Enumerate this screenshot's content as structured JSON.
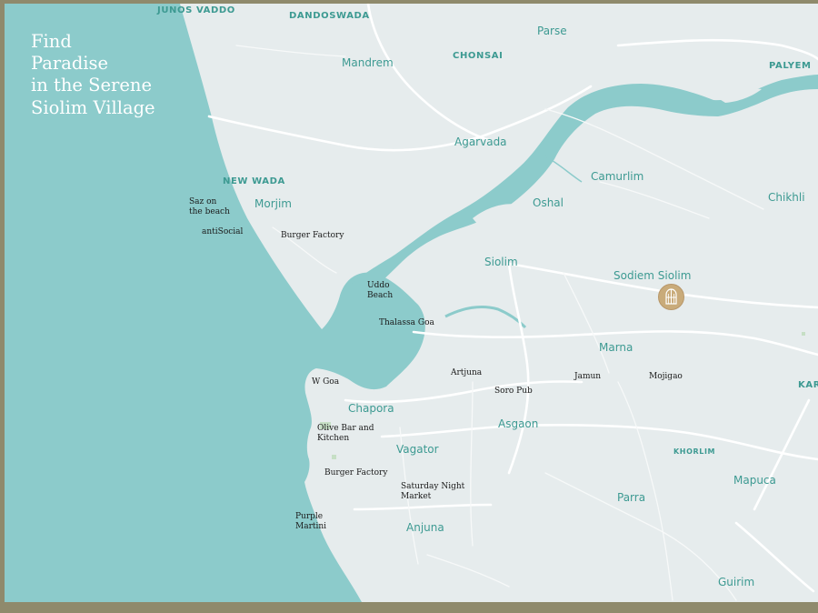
{
  "tagline": "Find\nParadise\nin the Serene\nSiolim Village",
  "colors": {
    "frame": "#8f8a6c",
    "land": "#e6eced",
    "water": "#8ccbcb",
    "road_major": "#ffffff",
    "road_minor": "#f6f8f8",
    "label_place": "#3d9a92",
    "label_poi": "#1a1a1a",
    "marker": "#c9ab7a"
  },
  "marker": {
    "label": "Sodiem Siolim",
    "icon": "arched-window-icon"
  },
  "places": [
    {
      "id": "junos-vaddo",
      "text": "JUNOS VADDO",
      "style": "caps"
    },
    {
      "id": "dandoswada",
      "text": "DANDOSWADA",
      "style": "caps"
    },
    {
      "id": "parse",
      "text": "Parse",
      "style": "town"
    },
    {
      "id": "mandrem",
      "text": "Mandrem",
      "style": "town"
    },
    {
      "id": "chonsai",
      "text": "CHONSAI",
      "style": "caps"
    },
    {
      "id": "palyem",
      "text": "PALYEM",
      "style": "caps"
    },
    {
      "id": "agarvada",
      "text": "Agarvada",
      "style": "town"
    },
    {
      "id": "camurlim",
      "text": "Camurlim",
      "style": "town"
    },
    {
      "id": "new-wada",
      "text": "NEW WADA",
      "style": "caps"
    },
    {
      "id": "chikhli",
      "text": "Chikhli",
      "style": "town"
    },
    {
      "id": "morjim",
      "text": "Morjim",
      "style": "town"
    },
    {
      "id": "oshal",
      "text": "Oshal",
      "style": "town"
    },
    {
      "id": "siolim",
      "text": "Siolim",
      "style": "town"
    },
    {
      "id": "marna",
      "text": "Marna",
      "style": "town"
    },
    {
      "id": "kar",
      "text": "KAR",
      "style": "caps"
    },
    {
      "id": "chapora",
      "text": "Chapora",
      "style": "town"
    },
    {
      "id": "asgaon",
      "text": "Asgaon",
      "style": "town"
    },
    {
      "id": "khorlim",
      "text": "KHORLIM",
      "style": "caps-sm"
    },
    {
      "id": "vagator",
      "text": "Vagator",
      "style": "town"
    },
    {
      "id": "mapuca",
      "text": "Mapuca",
      "style": "town"
    },
    {
      "id": "parra",
      "text": "Parra",
      "style": "town"
    },
    {
      "id": "anjuna",
      "text": "Anjuna",
      "style": "town"
    },
    {
      "id": "guirim",
      "text": "Guirim",
      "style": "town"
    }
  ],
  "pois": [
    {
      "id": "saz-on-the-beach",
      "text": "Saz on\nthe beach"
    },
    {
      "id": "antisocial",
      "text": "antiSocial"
    },
    {
      "id": "burger-factory-morjim",
      "text": "Burger Factory"
    },
    {
      "id": "uddo-beach",
      "text": "Uddo\nBeach"
    },
    {
      "id": "thalassa-goa",
      "text": "Thalassa Goa"
    },
    {
      "id": "w-goa",
      "text": "W Goa"
    },
    {
      "id": "arpora-artjuna",
      "text": "Artjuna"
    },
    {
      "id": "soro-pub",
      "text": "Soro Pub"
    },
    {
      "id": "jamun",
      "text": "Jamun"
    },
    {
      "id": "mojigao",
      "text": "Mojigao"
    },
    {
      "id": "olive-bar",
      "text": "Olive Bar and\nKitchen"
    },
    {
      "id": "burger-factory-vagator",
      "text": "Burger Factory"
    },
    {
      "id": "saturday-night-market",
      "text": "Saturday Night\nMarket"
    },
    {
      "id": "purple-martini",
      "text": "Purple\nMartini"
    }
  ]
}
